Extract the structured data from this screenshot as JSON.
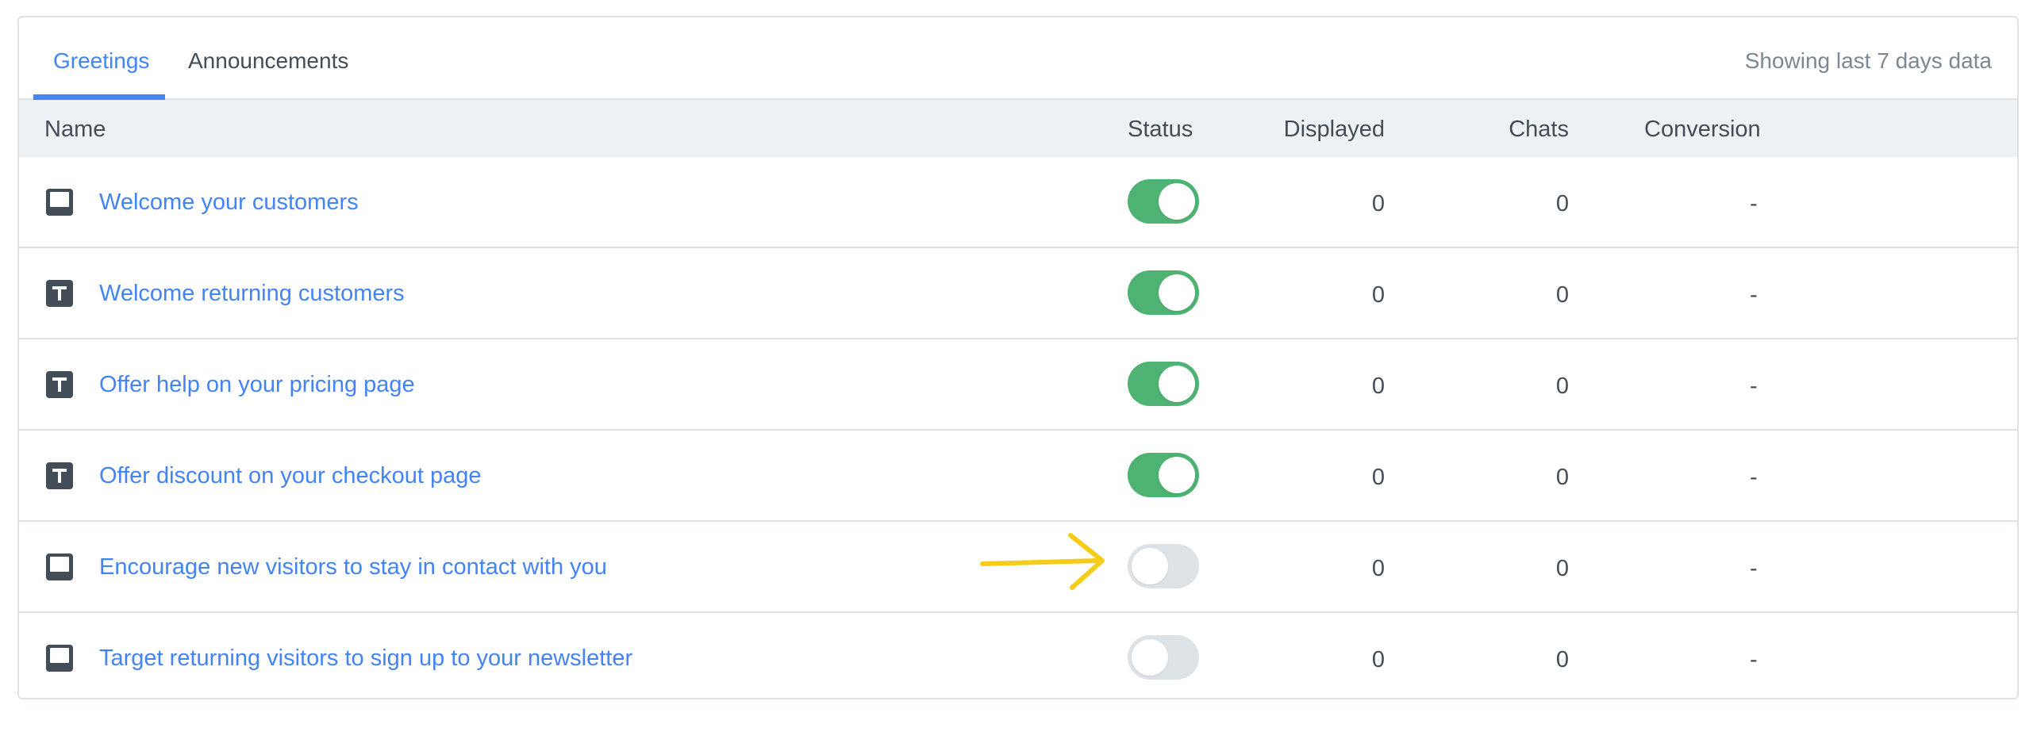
{
  "tabs": [
    {
      "label": "Greetings",
      "active": true
    },
    {
      "label": "Announcements",
      "active": false
    }
  ],
  "period_note": "Showing last 7 days data",
  "table": {
    "columns": {
      "name": "Name",
      "status": "Status",
      "displayed": "Displayed",
      "chats": "Chats",
      "conversion": "Conversion"
    },
    "rows": [
      {
        "icon": "popup-icon",
        "name": "Welcome your customers",
        "enabled": true,
        "displayed": "0",
        "chats": "0",
        "conversion": "-"
      },
      {
        "icon": "text-icon",
        "name": "Welcome returning customers",
        "enabled": true,
        "displayed": "0",
        "chats": "0",
        "conversion": "-"
      },
      {
        "icon": "text-icon",
        "name": "Offer help on your pricing page",
        "enabled": true,
        "displayed": "0",
        "chats": "0",
        "conversion": "-"
      },
      {
        "icon": "text-icon",
        "name": "Offer discount on your checkout page",
        "enabled": true,
        "displayed": "0",
        "chats": "0",
        "conversion": "-"
      },
      {
        "icon": "popup-icon",
        "name": "Encourage new visitors to stay in contact with you",
        "enabled": false,
        "displayed": "0",
        "chats": "0",
        "conversion": "-"
      },
      {
        "icon": "popup-icon",
        "name": "Target returning visitors to sign up to your newsletter",
        "enabled": false,
        "displayed": "0",
        "chats": "0",
        "conversion": "-"
      }
    ]
  },
  "annotation": {
    "icon": "yellow-arrow-icon",
    "color": "#f5cc1a"
  },
  "colors": {
    "accent": "#4384f5",
    "toggle_on": "#4db272",
    "toggle_off": "#dde2e6",
    "header_bg": "#eef2f5",
    "text": "#424d57"
  }
}
